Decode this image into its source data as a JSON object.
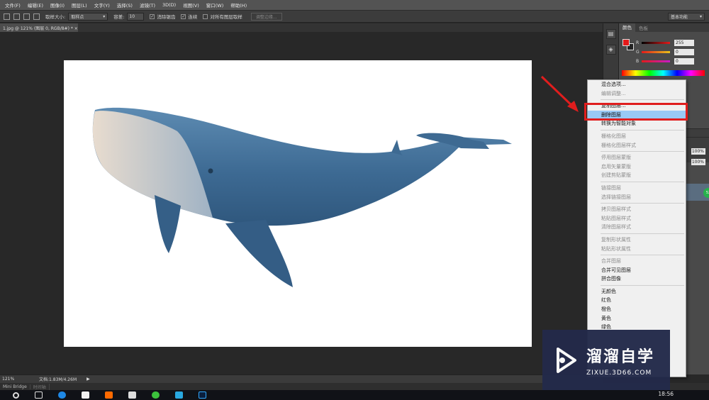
{
  "menubar": {
    "items": [
      "文件(F)",
      "编辑(E)",
      "图像(I)",
      "图层(L)",
      "文字(Y)",
      "选择(S)",
      "滤镜(T)",
      "3D(D)",
      "视图(V)",
      "窗口(W)",
      "帮助(H)"
    ]
  },
  "options": {
    "sample_size_label": "取样大小:",
    "sample_size_value": "取样点",
    "tolerance_label": "容差:",
    "tolerance_value": "10",
    "antialias_label": "消除锯齿",
    "contiguous_label": "连续",
    "sample_all_label": "对所有图层取样",
    "refine_edge_label": "调整边缘...",
    "workspace_value": "基本功能"
  },
  "document": {
    "tab_title": "1.jpg @ 121% (图层 0, RGB/8#) *",
    "close": "×"
  },
  "status": {
    "zoom": "121%",
    "doc_size": "文档:1.83M/4.26M",
    "arrow": "▶"
  },
  "bottom_tabs": [
    "Mini Bridge",
    "时间轴"
  ],
  "color_panel": {
    "tabs": [
      "颜色",
      "色板"
    ],
    "channels": [
      {
        "name": "R",
        "value": "255",
        "color": "#e41a1a"
      },
      {
        "name": "G",
        "value": "0",
        "color": "#e6c21a"
      },
      {
        "name": "B",
        "value": "0",
        "color": "#c81ac8"
      }
    ]
  },
  "layers_panel": {
    "opacity": "100%",
    "fill": "100%",
    "badge": "52"
  },
  "context_menu": {
    "items": [
      {
        "label": "混合选项...",
        "enabled": true
      },
      {
        "label": "编辑调整...",
        "enabled": false
      },
      {
        "label": "复制图层...",
        "enabled": true
      },
      {
        "label": "删除图层",
        "enabled": true,
        "highlighted": true
      },
      {
        "label": "转换为智能对象",
        "enabled": true
      },
      {
        "label": "栅格化图层",
        "enabled": false
      },
      {
        "label": "栅格化图层样式",
        "enabled": false
      },
      {
        "label": "停用图层蒙版",
        "enabled": false
      },
      {
        "label": "启用矢量蒙版",
        "enabled": false
      },
      {
        "label": "创建剪贴蒙版",
        "enabled": false
      },
      {
        "label": "链接图层",
        "enabled": false
      },
      {
        "label": "选择链接图层",
        "enabled": false
      },
      {
        "label": "拷贝图层样式",
        "enabled": false
      },
      {
        "label": "粘贴图层样式",
        "enabled": false
      },
      {
        "label": "清除图层样式",
        "enabled": false
      },
      {
        "label": "复制形状属性",
        "enabled": false
      },
      {
        "label": "粘贴形状属性",
        "enabled": false
      },
      {
        "label": "合并图层",
        "enabled": false
      },
      {
        "label": "合并可见图层",
        "enabled": true
      },
      {
        "label": "拼合图像",
        "enabled": true
      },
      {
        "label": "无颜色",
        "enabled": true
      },
      {
        "label": "红色",
        "enabled": true
      },
      {
        "label": "橙色",
        "enabled": true
      },
      {
        "label": "黄色",
        "enabled": true
      },
      {
        "label": "绿色",
        "enabled": true
      }
    ]
  },
  "taskbar": {
    "time": "18:56",
    "apps": [
      "search",
      "task-view",
      "edge",
      "store",
      "xiaomi",
      "mail",
      "wechat",
      "file-explorer",
      "photoshop"
    ]
  },
  "watermark": {
    "brand": "溜溜自学",
    "url": "ZIXUE.3D66.COM"
  },
  "colors": {
    "highlight": "#99c9f5",
    "annotation_red": "#e01d1d",
    "whale": "#3f6e96"
  }
}
